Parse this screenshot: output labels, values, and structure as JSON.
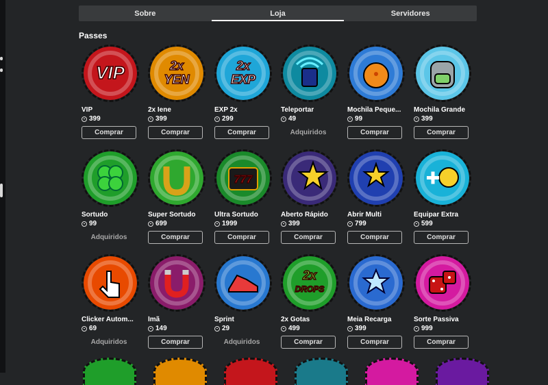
{
  "tabs": [
    {
      "label": "Sobre",
      "active": false
    },
    {
      "label": "Loja",
      "active": true
    },
    {
      "label": "Servidores",
      "active": false
    }
  ],
  "section_title": "Passes",
  "buy_label": "Comprar",
  "owned_label": "Adquiridos",
  "items": [
    {
      "name": "VIP",
      "price": "399",
      "owned": false,
      "icon": "vip-icon",
      "color": "#c4161c"
    },
    {
      "name": "2x Iene",
      "price": "399",
      "owned": false,
      "icon": "yen-icon",
      "color": "#e08a00"
    },
    {
      "name": "EXP 2x",
      "price": "299",
      "owned": false,
      "icon": "exp-icon",
      "color": "#1fa6d8"
    },
    {
      "name": "Teleportar",
      "price": "49",
      "owned": true,
      "icon": "teleport-icon",
      "color": "#0e8aa0"
    },
    {
      "name": "Mochila Peque...",
      "price": "99",
      "owned": false,
      "icon": "small-backpack-icon",
      "color": "#2e7bd6"
    },
    {
      "name": "Mochila Grande",
      "price": "399",
      "owned": false,
      "icon": "large-backpack-icon",
      "color": "#5cc6e8"
    },
    {
      "name": "Sortudo",
      "price": "99",
      "owned": true,
      "icon": "clover-icon",
      "color": "#1f9e2a"
    },
    {
      "name": "Super Sortudo",
      "price": "699",
      "owned": false,
      "icon": "horseshoe-icon",
      "color": "#2fa82f"
    },
    {
      "name": "Ultra Sortudo",
      "price": "1999",
      "owned": false,
      "icon": "slot-machine-icon",
      "color": "#1a8a2a"
    },
    {
      "name": "Aberto Rápido",
      "price": "399",
      "owned": false,
      "icon": "fast-open-icon",
      "color": "#3a2a78"
    },
    {
      "name": "Abrir Multi",
      "price": "799",
      "owned": false,
      "icon": "multi-open-icon",
      "color": "#2040b0"
    },
    {
      "name": "Equipar Extra",
      "price": "599",
      "owned": false,
      "icon": "equip-extra-icon",
      "color": "#19b2d8"
    },
    {
      "name": "Clicker Autom...",
      "price": "69",
      "owned": true,
      "icon": "auto-clicker-icon",
      "color": "#e84a00"
    },
    {
      "name": "Ímã",
      "price": "149",
      "owned": false,
      "icon": "magnet-icon",
      "color": "#8a1c6a"
    },
    {
      "name": "Sprint",
      "price": "29",
      "owned": true,
      "icon": "sprint-icon",
      "color": "#2878d0"
    },
    {
      "name": "2x Gotas",
      "price": "499",
      "owned": false,
      "icon": "drops-icon",
      "color": "#1f9e2a"
    },
    {
      "name": "Meia Recarga",
      "price": "399",
      "owned": false,
      "icon": "half-cooldown-icon",
      "color": "#2a6ad0"
    },
    {
      "name": "Sorte Passiva",
      "price": "999",
      "owned": false,
      "icon": "dice-icon",
      "color": "#d41aa0"
    }
  ],
  "partial_row_colors": [
    "#1f9e2a",
    "#e08a00",
    "#c4161c",
    "#1a7a8a",
    "#d41aa0",
    "#6a1aa0"
  ]
}
